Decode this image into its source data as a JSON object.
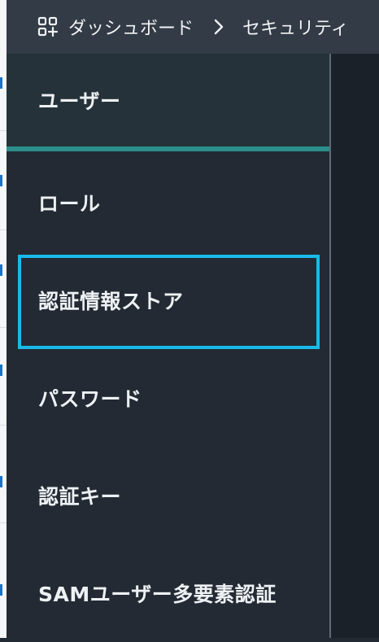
{
  "breadcrumb": {
    "items": [
      "ダッシュボード",
      "セキュリティ"
    ]
  },
  "sidebar": {
    "items": [
      {
        "label": "ユーザー",
        "active": true
      },
      {
        "label": "ロール",
        "active": false
      },
      {
        "label": "認証情報ストア",
        "active": false,
        "focused": true
      },
      {
        "label": "パスワード",
        "active": false
      },
      {
        "label": "認証キー",
        "active": false
      },
      {
        "label": "SAMユーザー多要素認証",
        "active": false
      }
    ]
  },
  "colors": {
    "topbar_bg": "#323b46",
    "panel_bg": "#232a33",
    "active_underline": "#2b8e8a",
    "focus_ring": "#19b9ea"
  }
}
